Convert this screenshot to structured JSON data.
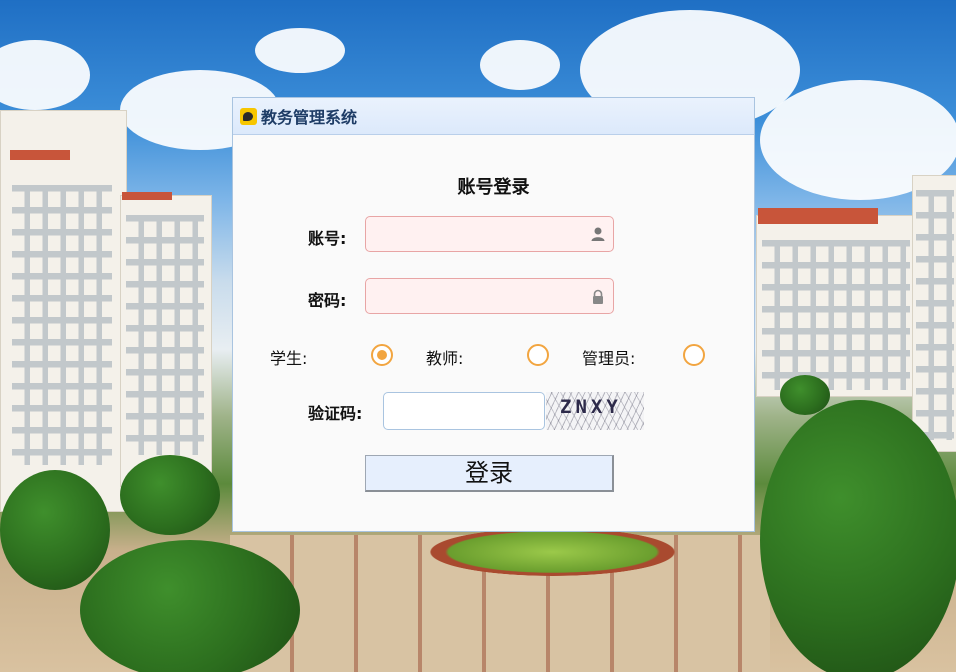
{
  "window": {
    "title": "教务管理系统",
    "icon": "app-logo-icon"
  },
  "form": {
    "heading": "账号登录",
    "account_label": "账号:",
    "account_value": "",
    "account_icon": "user-icon",
    "password_label": "密码:",
    "password_value": "",
    "password_icon": "lock-icon",
    "roles": [
      {
        "label": "学生:",
        "selected": true
      },
      {
        "label": "教师:",
        "selected": false
      },
      {
        "label": "管理员:",
        "selected": false
      }
    ],
    "captcha_label": "验证码:",
    "captcha_value": "",
    "captcha_text": "ZNXY",
    "login_label": "登录"
  },
  "colors": {
    "radio_accent": "#f2a540",
    "input_error_bg": "#fff1f1",
    "input_error_border": "#e8a5a5",
    "title_text": "#1e3c66",
    "button_bg": "#e6effd"
  }
}
